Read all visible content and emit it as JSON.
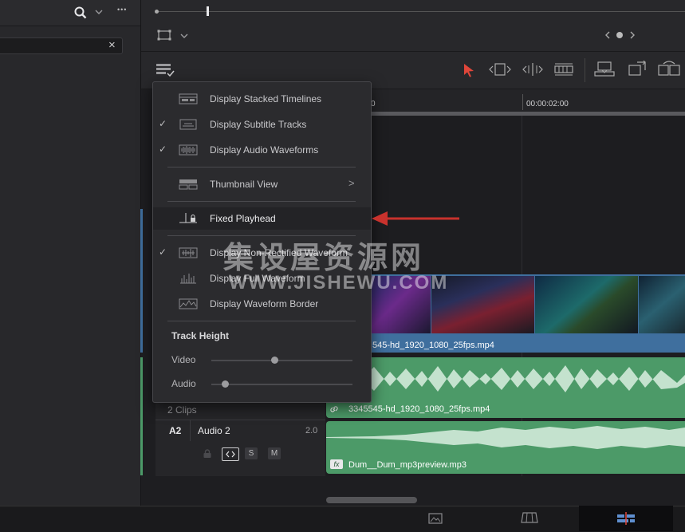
{
  "colors": {
    "accent": "#e0463a",
    "video_clip": "#3f6f9e",
    "audio_clip": "#4c9a68",
    "arrow": "#c8322d"
  },
  "left_panel": {
    "search_icon": "search-icon",
    "more_icon": "ellipsis-icon",
    "clear_icon": "close-icon",
    "clear_glyph": "×",
    "more_glyph": "•••"
  },
  "ruler": {
    "timecode_a": "0",
    "timecode_b": "00:00:02:00"
  },
  "menu": {
    "items": [
      {
        "label": "Display Stacked Timelines",
        "checked": false,
        "icon": "stacked-timelines-icon"
      },
      {
        "label": "Display Subtitle Tracks",
        "checked": true,
        "icon": "subtitle-tracks-icon"
      },
      {
        "label": "Display Audio Waveforms",
        "checked": true,
        "icon": "audio-waveform-icon"
      },
      {
        "label": "Thumbnail View",
        "checked": false,
        "icon": "thumbnail-view-icon",
        "submenu": true
      },
      {
        "label": "Fixed Playhead",
        "checked": false,
        "icon": "fixed-playhead-icon",
        "highlighted": true
      },
      {
        "label": "Display Non-Rectified Waveform",
        "checked": true,
        "icon": "non-rectified-waveform-icon"
      },
      {
        "label": "Display Full Waveform",
        "checked": false,
        "icon": "full-waveform-icon"
      },
      {
        "label": "Display Waveform Border",
        "checked": false,
        "icon": "waveform-border-icon"
      }
    ],
    "check_glyph": "✓",
    "submenu_glyph": ">",
    "track_height_title": "Track Height",
    "video_label": "Video",
    "audio_label": "Audio",
    "video_height": 0.45,
    "audio_height": 0.1
  },
  "tracks": {
    "v1_clip_name": "545-hd_1920_1080_25fps.mp4",
    "a1_clip_count": "2 Clips",
    "a1_clip_name": "3345545-hd_1920_1080_25fps.mp4",
    "a2_id": "A2",
    "a2_name": "Audio 2",
    "a2_volume": "2.0",
    "a2_solo": "S",
    "a2_mute": "M",
    "a2_clip_name": "Dum__Dum_mp3preview.mp3",
    "fx_badge": "fx"
  },
  "watermark": {
    "line1": "集设屋资源网",
    "line2": "WWW.JISHEWU.COM"
  }
}
